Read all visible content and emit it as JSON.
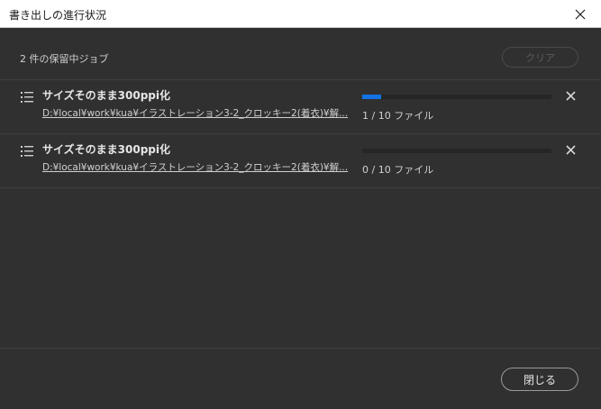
{
  "window": {
    "title": "書き出しの進行状況",
    "close_icon": "close-icon"
  },
  "summary": "2 件の保留中ジョブ",
  "clear_label": "クリア",
  "jobs": [
    {
      "name": "サイズそのまま300ppi化",
      "path": "D:¥local¥work¥kua¥イラストレーション3-2_クロッキー2(着衣)¥解...",
      "count": "1 / 10 ファイル",
      "progress": 0.1
    },
    {
      "name": "サイズそのまま300ppi化",
      "path": "D:¥local¥work¥kua¥イラストレーション3-2_クロッキー2(着衣)¥解...",
      "count": "0 / 10 ファイル",
      "progress": 0
    }
  ],
  "footer": {
    "close_label": "閉じる"
  },
  "colors": {
    "background": "#303030",
    "progress_accent": "#1473e6",
    "titlebar": "#ffffff"
  }
}
